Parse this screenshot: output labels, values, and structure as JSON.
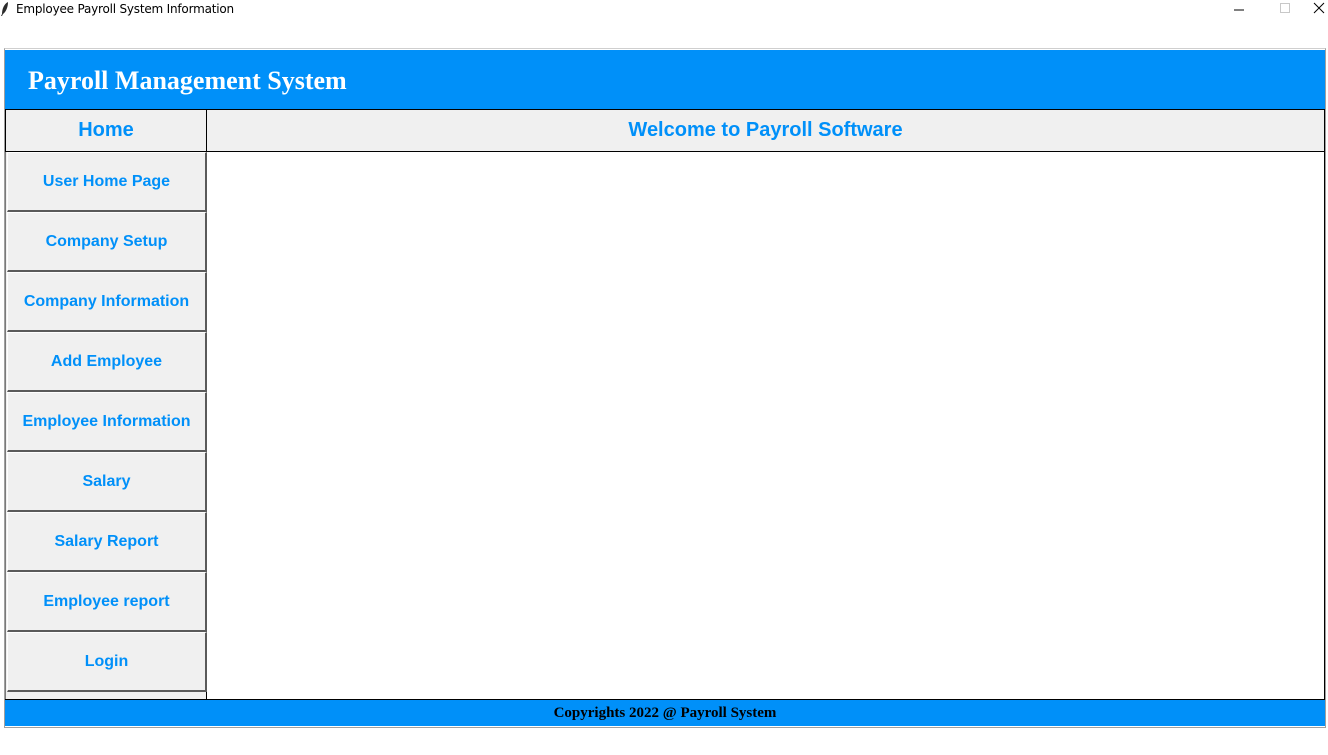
{
  "window": {
    "title": "Employee Payroll System Information"
  },
  "header": {
    "title": "Payroll Management System"
  },
  "sidebar": {
    "heading": "Home",
    "items": [
      {
        "label": "User Home Page"
      },
      {
        "label": "Company Setup"
      },
      {
        "label": "Company Information"
      },
      {
        "label": "Add Employee"
      },
      {
        "label": "Employee Information"
      },
      {
        "label": "Salary"
      },
      {
        "label": "Salary Report"
      },
      {
        "label": "Employee report"
      },
      {
        "label": "Login"
      }
    ]
  },
  "main": {
    "heading": "Welcome to Payroll Software"
  },
  "footer": {
    "text": "Copyrights 2022 @ Payroll System"
  },
  "colors": {
    "accent": "#0090f9",
    "panel": "#f0f0f0"
  },
  "icons": {
    "app": "feather-icon",
    "minimize": "minimize-icon",
    "maximize": "maximize-icon",
    "close": "close-icon"
  }
}
